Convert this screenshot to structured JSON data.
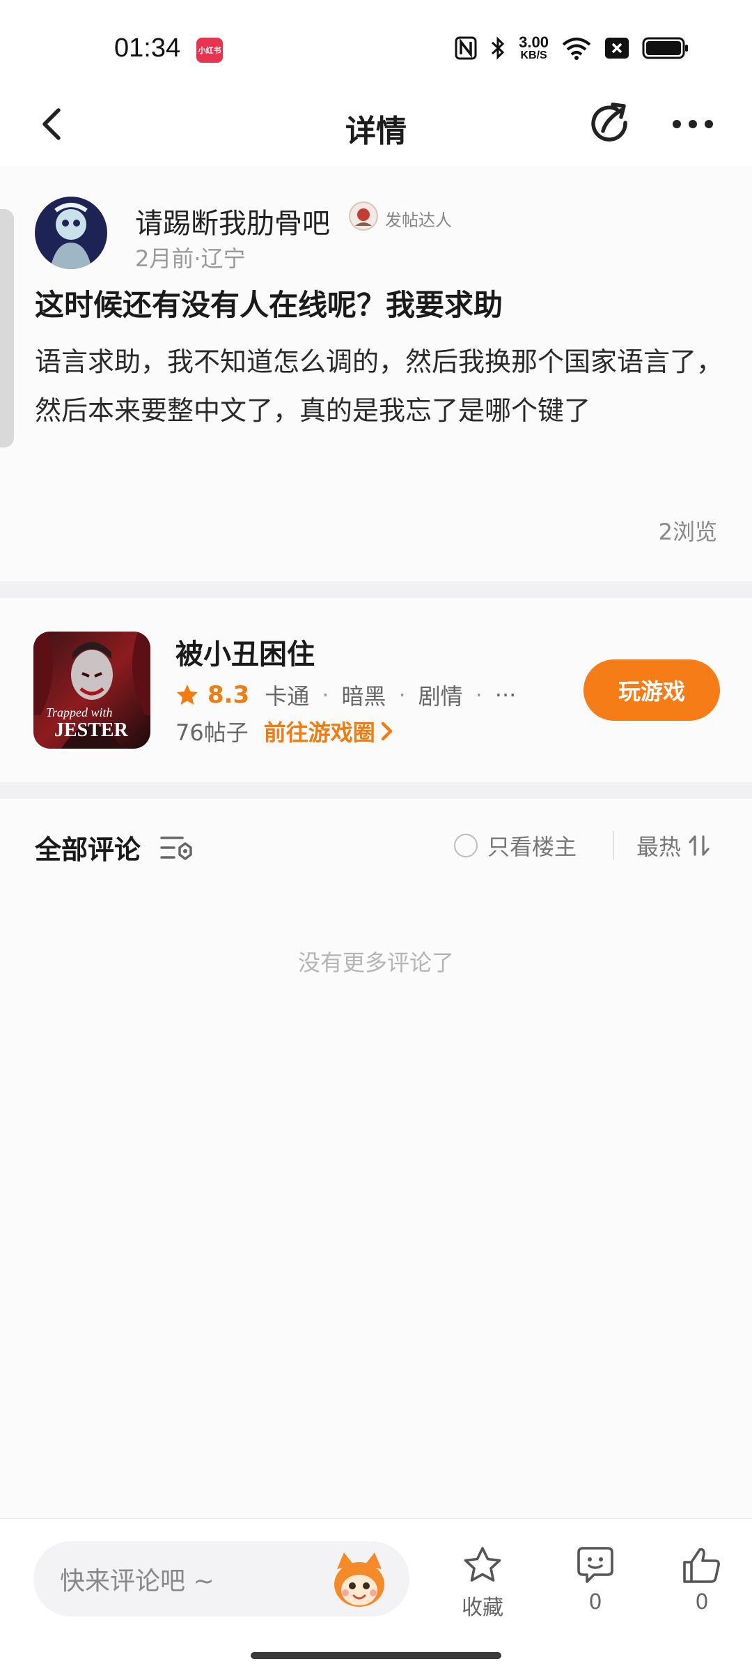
{
  "status": {
    "time": "01:34",
    "app_badge": "小红书",
    "net_speed_value": "3.00",
    "net_speed_unit": "KB/S"
  },
  "nav": {
    "title": "详情",
    "share_icon": "share-icon",
    "more_icon": "more-icon"
  },
  "post": {
    "author": "请踢断我肋骨吧",
    "badge": "发帖达人",
    "meta": "2月前·辽宁",
    "title": "这时候还有没有人在线呢？我要求助",
    "body": "语言求助，我不知道怎么调的，然后我换那个国家语言了，然后本来要整中文了，真的是我忘了是哪个键了",
    "views": "2浏览"
  },
  "game": {
    "name": "被小丑困住",
    "cover_text_1": "Trapped with",
    "cover_text_2": "JESTER",
    "rating": "8.3",
    "tags": [
      "卡通",
      "暗黑",
      "剧情"
    ],
    "tags_more": "···",
    "post_count": "76帖子",
    "goto_label": "前往游戏圈",
    "play_label": "玩游戏"
  },
  "comments": {
    "title": "全部评论",
    "only_op_label": "只看楼主",
    "sort_label": "最热",
    "empty_text": "没有更多评论了"
  },
  "bottom": {
    "input_placeholder": "快来评论吧 ~",
    "favorite_label": "收藏",
    "comment_count": "0",
    "like_count": "0"
  },
  "colors": {
    "accent": "#f57c16",
    "rating": "#f27b12"
  }
}
